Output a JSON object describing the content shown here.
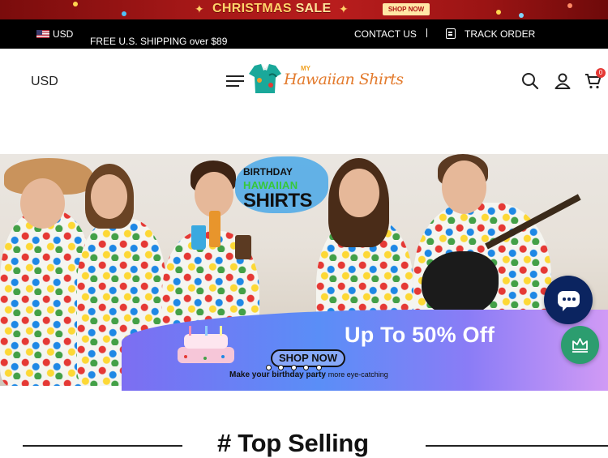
{
  "promo": {
    "title_prefix": "CHRISTMAS",
    "title_suffix": "SALE",
    "button_label": "SHOP NOW",
    "accent": "#ffd36a",
    "background": "#a31717"
  },
  "topbar": {
    "currency": "USD",
    "shipping_text": "FREE U.S. SHIPPING over $89",
    "contact_label": "CONTACT US",
    "track_label": "TRACK ORDER"
  },
  "header": {
    "currency": "USD",
    "logo_small": "MY",
    "logo_main": "Hawaiian Shirts",
    "cart_count": "0",
    "icons": [
      "menu-icon",
      "search-icon",
      "user-icon",
      "cart-icon"
    ]
  },
  "hero": {
    "line1": "BIRTHDAY",
    "line2": "HAWAIIAN",
    "line3": "SHIRTS",
    "offer": "Up To 50% Off",
    "cta": "SHOP NOW",
    "tagline_bold": "Make your birthday party",
    "tagline_rest": "more eye-catching"
  },
  "section": {
    "title": "# Top Selling"
  },
  "floating": {
    "chat_color": "#0b2460",
    "rewards_color": "#2c9d6f"
  }
}
